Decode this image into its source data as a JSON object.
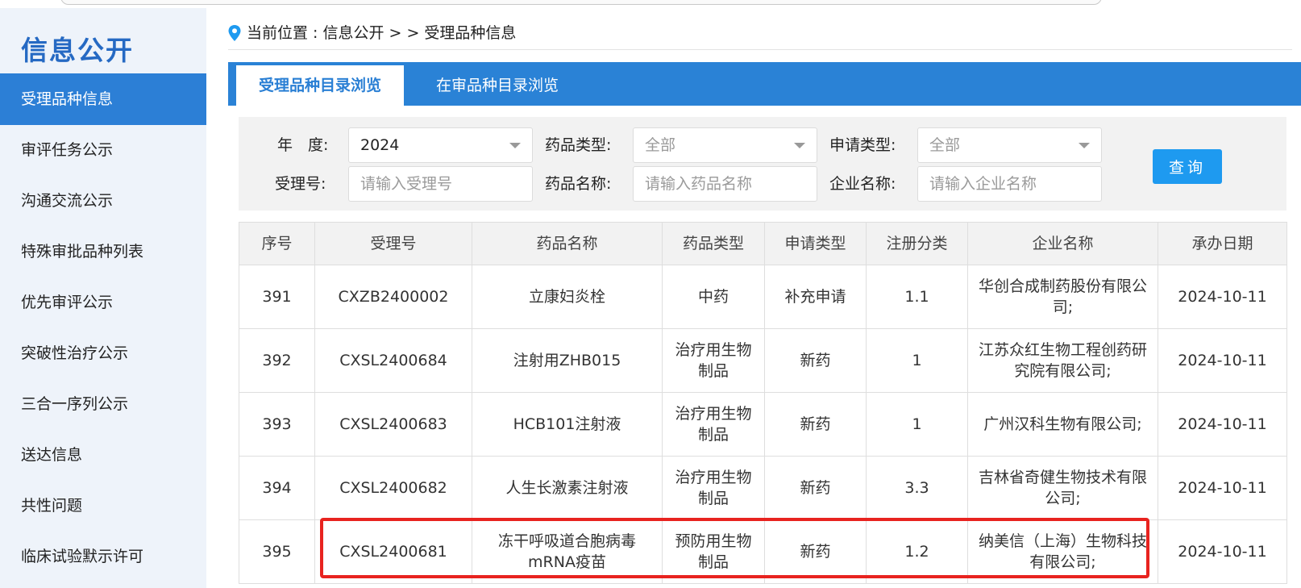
{
  "sidebar": {
    "title": "信息公开",
    "items": [
      {
        "label": "受理品种信息"
      },
      {
        "label": "审评任务公示"
      },
      {
        "label": "沟通交流公示"
      },
      {
        "label": "特殊审批品种列表"
      },
      {
        "label": "优先审评公示"
      },
      {
        "label": "突破性治疗公示"
      },
      {
        "label": "三合一序列公示"
      },
      {
        "label": "送达信息"
      },
      {
        "label": "共性问题"
      },
      {
        "label": "临床试验默示许可"
      }
    ]
  },
  "breadcrumb": {
    "prefix": "当前位置 : ",
    "level1": "信息公开",
    "sep": "> >",
    "level2": "受理品种信息"
  },
  "tabs": [
    {
      "label": "受理品种目录浏览"
    },
    {
      "label": "在审品种目录浏览"
    }
  ],
  "filters": {
    "year_label": "年　度:",
    "year_value": "2024",
    "drug_type_label": "药品类型:",
    "drug_type_value": "全部",
    "apply_type_label": "申请类型:",
    "apply_type_value": "全部",
    "accept_no_label": "受理号:",
    "accept_no_placeholder": "请输入受理号",
    "drug_name_label": "药品名称:",
    "drug_name_placeholder": "请输入药品名称",
    "company_label": "企业名称:",
    "company_placeholder": "请输入企业名称",
    "search_label": "查询"
  },
  "table": {
    "headers": [
      "序号",
      "受理号",
      "药品名称",
      "药品类型",
      "申请类型",
      "注册分类",
      "企业名称",
      "承办日期"
    ],
    "rows": [
      [
        "391",
        "CXZB2400002",
        "立康妇炎栓",
        "中药",
        "补充申请",
        "1.1",
        "华创合成制药股份有限公司;",
        "2024-10-11"
      ],
      [
        "392",
        "CXSL2400684",
        "注射用ZHB015",
        "治疗用生物制品",
        "新药",
        "1",
        "江苏众红生物工程创药研究院有限公司;",
        "2024-10-11"
      ],
      [
        "393",
        "CXSL2400683",
        "HCB101注射液",
        "治疗用生物制品",
        "新药",
        "1",
        "广州汉科生物有限公司;",
        "2024-10-11"
      ],
      [
        "394",
        "CXSL2400682",
        "人生长激素注射液",
        "治疗用生物制品",
        "新药",
        "3.3",
        "吉林省奇健生物技术有限公司;",
        "2024-10-11"
      ],
      [
        "395",
        "CXSL2400681",
        "冻干呼吸道合胞病毒mRNA疫苗",
        "预防用生物制品",
        "新药",
        "1.2",
        "纳美信（上海）生物科技有限公司;",
        "2024-10-11"
      ]
    ]
  },
  "colors": {
    "brand_blue": "#2a82d6",
    "active_side": "#2c7fd6",
    "title_blue": "#2569c3",
    "search_btn": "#1e9af0",
    "highlight_red": "#e8231f"
  },
  "icons": {
    "breadcrumb": "location-pin-icon",
    "select": "chevron-down-icon"
  }
}
